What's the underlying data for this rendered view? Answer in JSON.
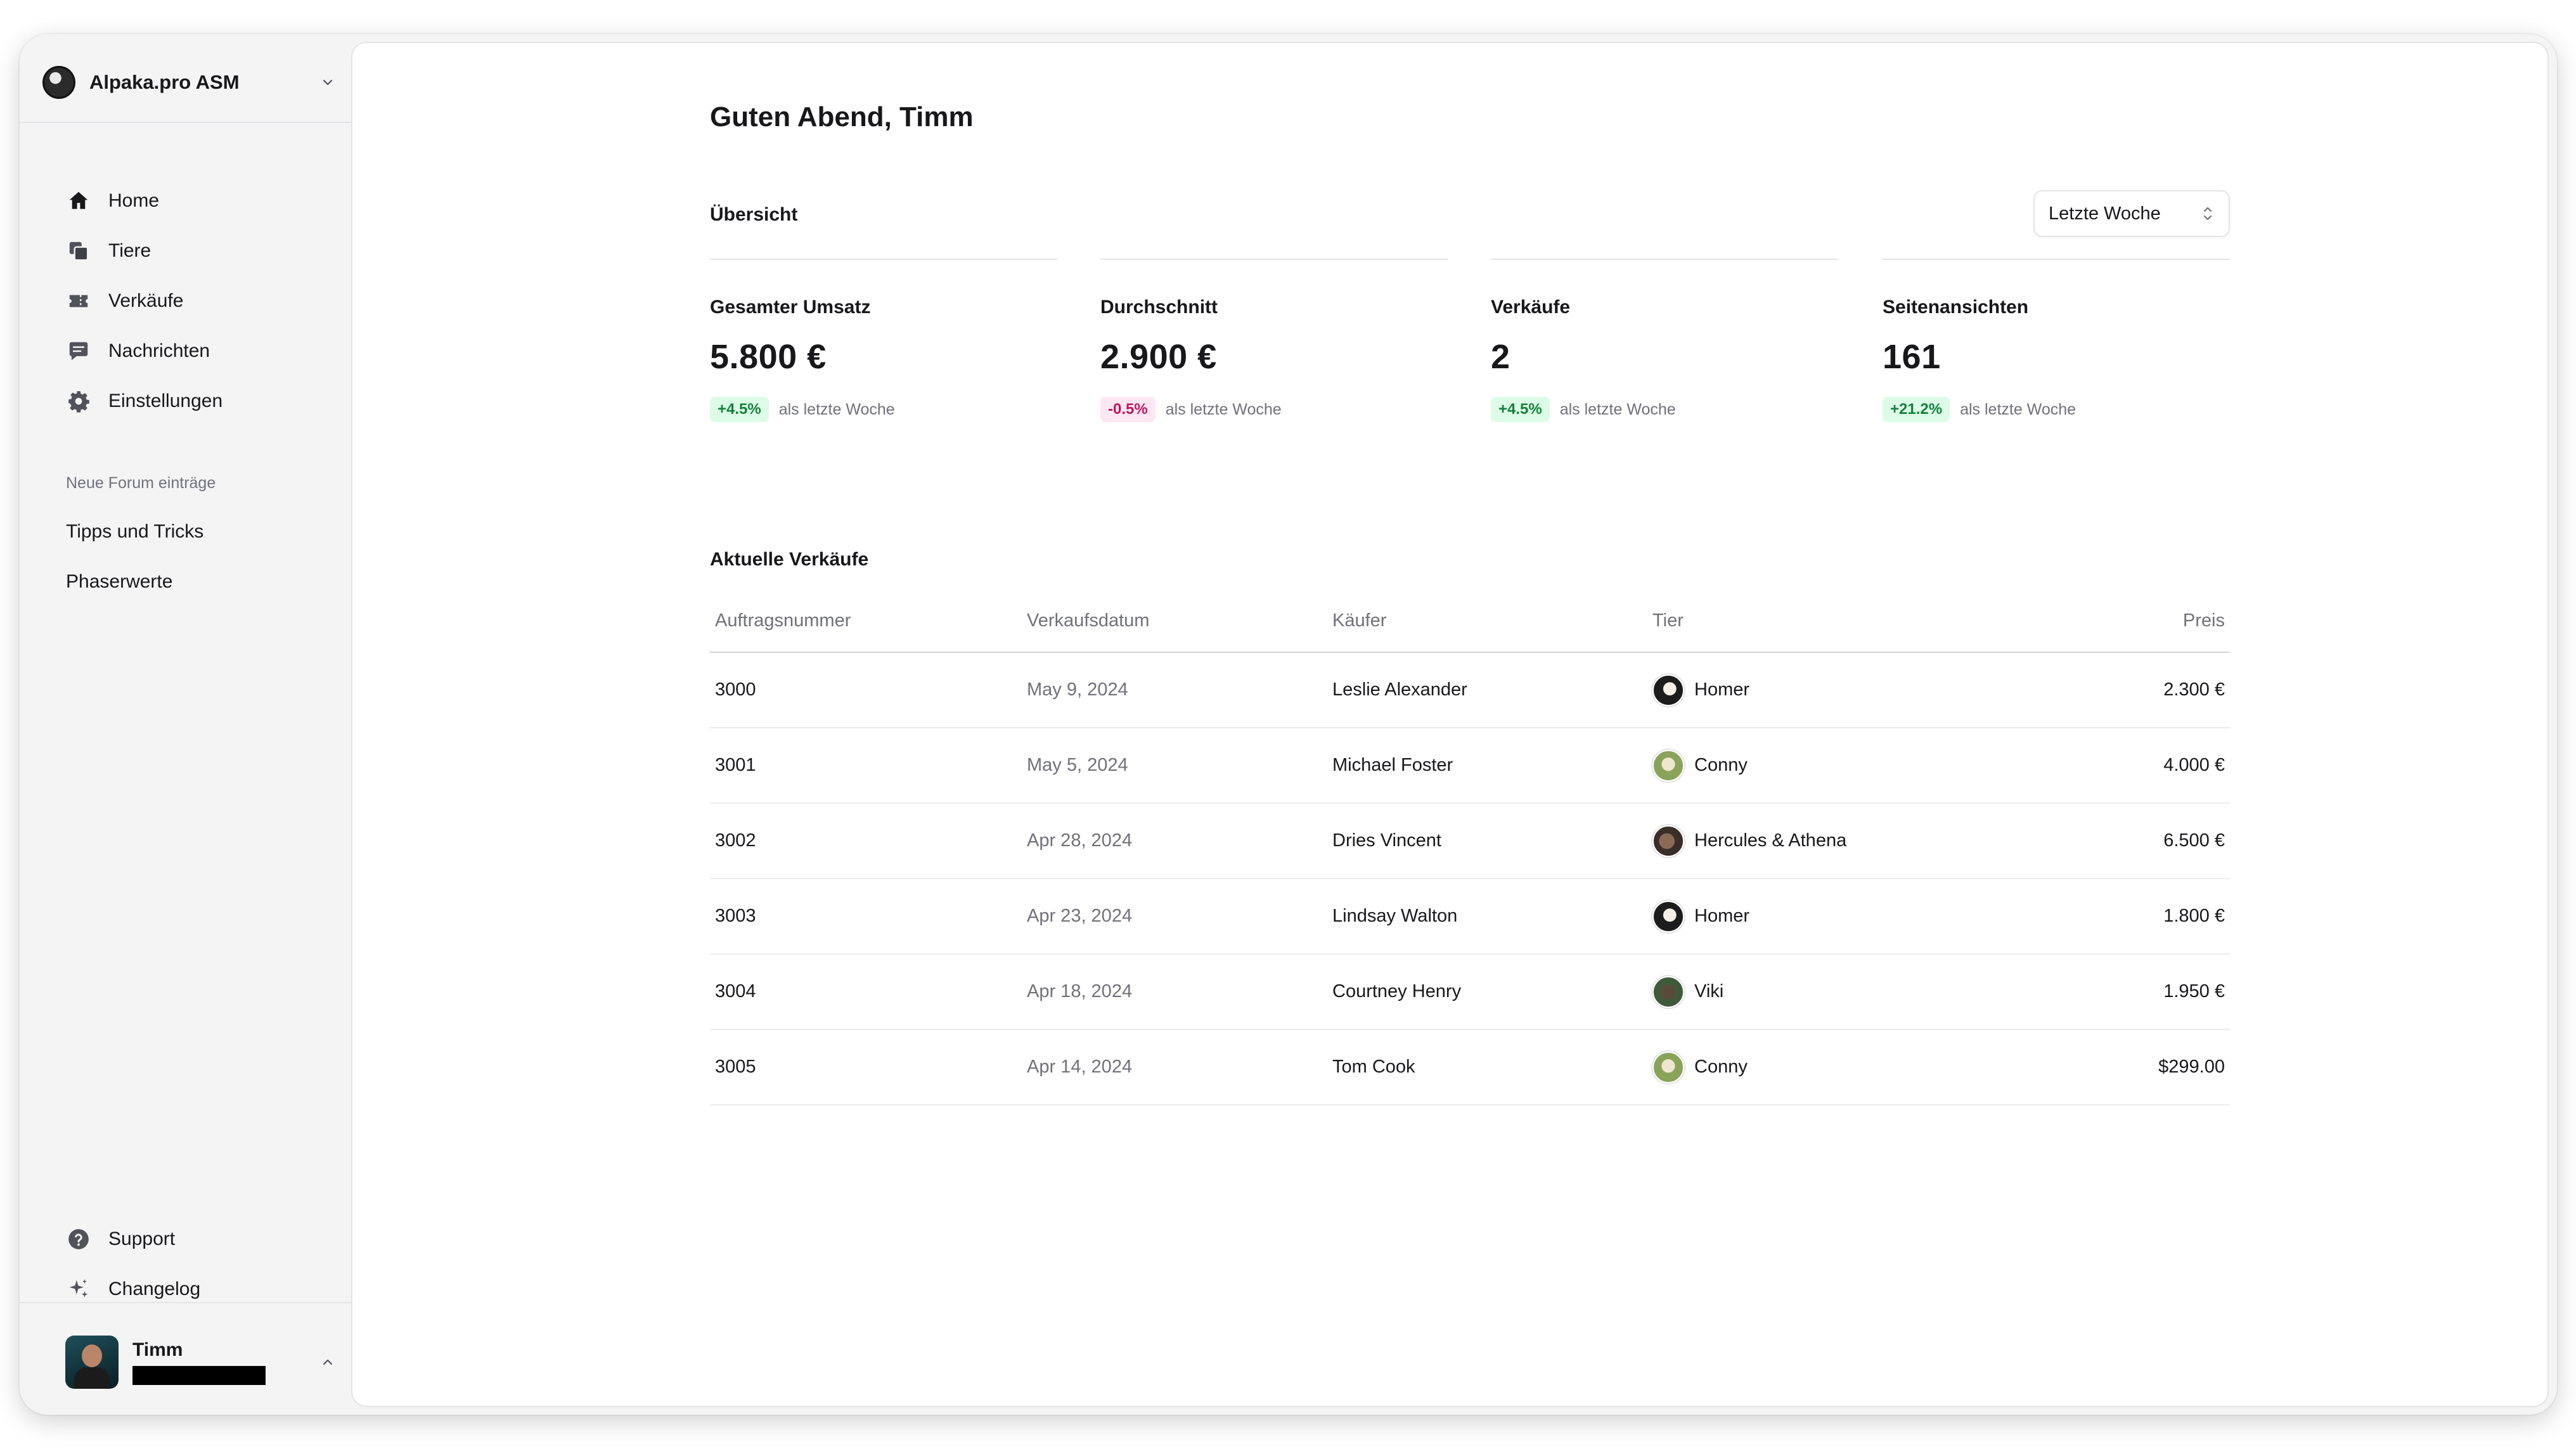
{
  "sidebar": {
    "team_name": "Alpaka.pro ASM",
    "nav": [
      {
        "label": "Home",
        "icon": "home-icon"
      },
      {
        "label": "Tiere",
        "icon": "squares-icon"
      },
      {
        "label": "Verkäufe",
        "icon": "ticket-icon"
      },
      {
        "label": "Nachrichten",
        "icon": "chat-icon"
      },
      {
        "label": "Einstellungen",
        "icon": "gear-icon"
      }
    ],
    "forum_heading": "Neue Forum einträge",
    "forum_items": [
      "Tipps und Tricks",
      "Phaserwerte"
    ],
    "bottom_nav": [
      {
        "label": "Support",
        "icon": "question-icon"
      },
      {
        "label": "Changelog",
        "icon": "sparkles-icon"
      }
    ],
    "user": {
      "name": "Timm"
    }
  },
  "main": {
    "greeting": "Guten Abend, Timm",
    "overview_title": "Übersicht",
    "period": "Letzte Woche",
    "stats": [
      {
        "label": "Gesamter Umsatz",
        "value": "5.800 €",
        "change": "+4.5%",
        "trend": "positive",
        "suffix": "als letzte Woche"
      },
      {
        "label": "Durchschnitt",
        "value": "2.900 €",
        "change": "-0.5%",
        "trend": "negative",
        "suffix": "als letzte Woche"
      },
      {
        "label": "Verkäufe",
        "value": "2",
        "change": "+4.5%",
        "trend": "positive",
        "suffix": "als letzte Woche"
      },
      {
        "label": "Seitenansichten",
        "value": "161",
        "change": "+21.2%",
        "trend": "positive",
        "suffix": "als letzte Woche"
      }
    ],
    "sales_title": "Aktuelle Verkäufe",
    "table": {
      "headers": [
        "Auftragsnummer",
        "Verkaufsdatum",
        "Käufer",
        "Tier",
        "Preis"
      ],
      "rows": [
        {
          "order": "3000",
          "date": "May 9, 2024",
          "buyer": "Leslie Alexander",
          "pet": "Homer",
          "pet_avatar": "homer",
          "price": "2.300 €"
        },
        {
          "order": "3001",
          "date": "May 5, 2024",
          "buyer": "Michael Foster",
          "pet": "Conny",
          "pet_avatar": "conny",
          "price": "4.000 €"
        },
        {
          "order": "3002",
          "date": "Apr 28, 2024",
          "buyer": "Dries Vincent",
          "pet": "Hercules & Athena",
          "pet_avatar": "hercules",
          "price": "6.500 €"
        },
        {
          "order": "3003",
          "date": "Apr 23, 2024",
          "buyer": "Lindsay Walton",
          "pet": "Homer",
          "pet_avatar": "homer",
          "price": "1.800 €"
        },
        {
          "order": "3004",
          "date": "Apr 18, 2024",
          "buyer": "Courtney Henry",
          "pet": "Viki",
          "pet_avatar": "viki",
          "price": "1.950 €"
        },
        {
          "order": "3005",
          "date": "Apr 14, 2024",
          "buyer": "Tom Cook",
          "pet": "Conny",
          "pet_avatar": "conny",
          "price": "$299.00"
        }
      ]
    }
  }
}
